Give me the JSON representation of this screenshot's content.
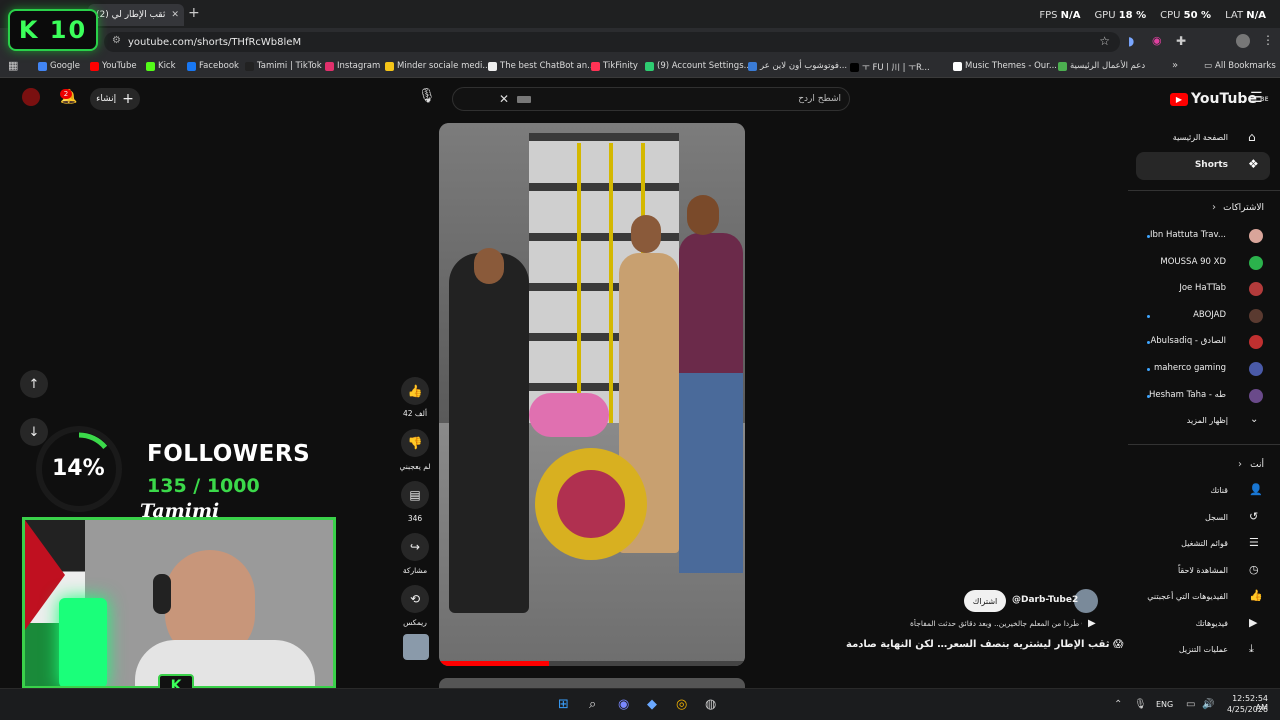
{
  "browser": {
    "tab_title": "(2) ثقب الإطار لي",
    "address": "youtube.com/shorts/THfRcWb8leM",
    "perf": [
      {
        "k": "FPS",
        "v": "N/A"
      },
      {
        "k": "GPU",
        "v": "18 %"
      },
      {
        "k": "CPU",
        "v": "50 %"
      },
      {
        "k": "LAT",
        "v": "N/A"
      }
    ],
    "bookmarks": [
      {
        "label": "Google",
        "color": "#4285f4"
      },
      {
        "label": "YouTube",
        "color": "#ff0000"
      },
      {
        "label": "Kick",
        "color": "#53fc18"
      },
      {
        "label": "Facebook",
        "color": "#1877f2"
      },
      {
        "label": "Tamimi | TikTok",
        "color": "#222222"
      },
      {
        "label": "Instagram",
        "color": "#e1306c"
      },
      {
        "label": "Minder sociale medi...",
        "color": "#f5c518"
      },
      {
        "label": "The best ChatBot an...",
        "color": "#eeeeee"
      },
      {
        "label": "TikFinity",
        "color": "#ff3355"
      },
      {
        "label": "(9) Account Settings...",
        "color": "#2ecc71"
      },
      {
        "label": "فوتوشوب أون لاين عر...",
        "color": "#3a7bd5"
      },
      {
        "label": "ㅜ FUㅣ川 | ㅜR...",
        "color": "#000000"
      },
      {
        "label": "Music Themes - Our...",
        "color": "#ffffff"
      },
      {
        "label": "دعم الأعمال الرئيسية",
        "color": "#4caf50"
      }
    ],
    "all_bookmarks": "All Bookmarks"
  },
  "overlay": {
    "k10": "K 10",
    "percent": "14%",
    "followers_label": "FOLLOWERS",
    "followers_count": "135 / 1000",
    "streamer": "Tamimi",
    "progress": 0.14
  },
  "yt": {
    "logo": "YouTube",
    "logo_suffix": "BE",
    "search_placeholder": "اشطح اردح",
    "create": "إنشاء",
    "notif_count": "2",
    "nav_home": "الصفحة الرئيسية",
    "nav_shorts": "Shorts",
    "subs_title": "الاشتراكات",
    "subs": [
      {
        "name": "Ibn Hattuta Trav...",
        "color": "#d9a59a",
        "dot": true
      },
      {
        "name": "MOUSSA 90 XD",
        "color": "#2bb24c",
        "dot": false
      },
      {
        "name": "Joe HaTTab",
        "color": "#b23b3b",
        "dot": false
      },
      {
        "name": "ABOJAD",
        "color": "#5a3a30",
        "dot": true
      },
      {
        "name": "Abulsadiq - الصادق",
        "color": "#c03030",
        "dot": true
      },
      {
        "name": "maherco gaming",
        "color": "#4a5aa8",
        "dot": true
      },
      {
        "name": "Hesham Taha - طه",
        "color": "#6a4a8a",
        "dot": true
      }
    ],
    "show_more": "إظهار المزيد",
    "you_title": "أنت",
    "you_items": [
      {
        "label": "قناتك",
        "icon": "👤"
      },
      {
        "label": "السجل",
        "icon": "↺"
      },
      {
        "label": "قوائم التشغيل",
        "icon": "☰"
      },
      {
        "label": "المشاهدة لاحقاً",
        "icon": "◷"
      },
      {
        "label": "الفيديوهات التي أعجبتني",
        "icon": "👍"
      },
      {
        "label": "فيديوهاتك",
        "icon": "▶"
      },
      {
        "label": "عمليات التنزيل",
        "icon": "⤓"
      }
    ],
    "likes": "42 ألف",
    "dislike_label": "لم يعجبني",
    "comments": "346",
    "share": "مشاركة",
    "remix": "ريمكس",
    "channel": "@Darb-Tube2",
    "subscribe": "اشتراك",
    "sub_text": "طُردا من المعلم جالخيرين.. وبعد دقائق حدثت المفاجأة 😱",
    "video_title": "ثقب الإطار ليشتريه بنصف السعر… لكن النهاية صادمة 😱"
  },
  "taskbar": {
    "lang": "ENG",
    "time": "12:52:54 AM",
    "date": "4/25/2026"
  }
}
